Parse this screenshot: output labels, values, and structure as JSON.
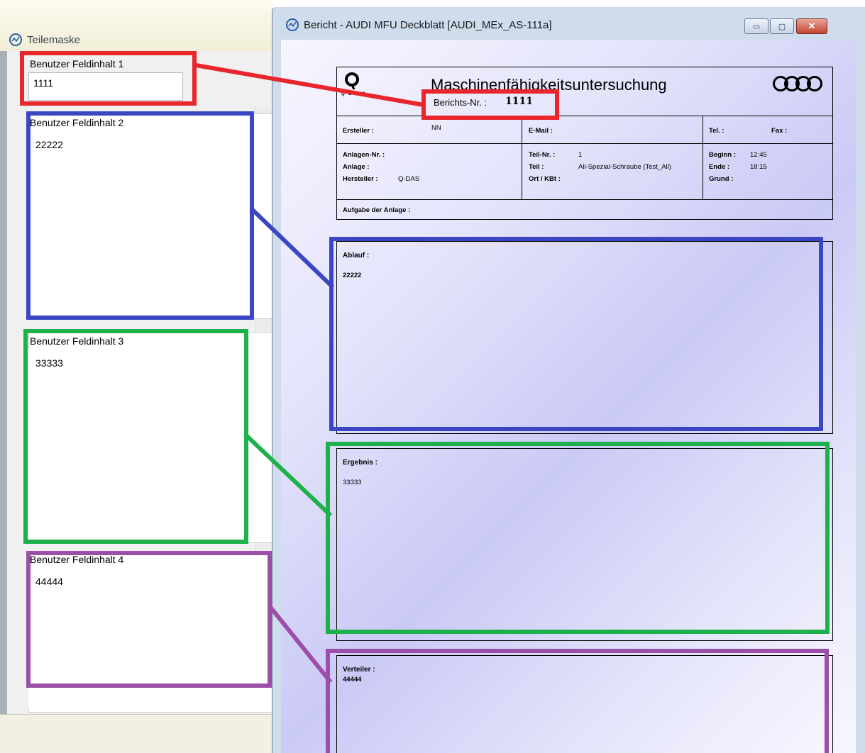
{
  "left_window": {
    "title": "Teilemaske",
    "fields": [
      {
        "label": "Benutzer Feldinhalt 1",
        "value": "1111"
      },
      {
        "label": "Benutzer Feldinhalt 2",
        "value": "22222"
      },
      {
        "label": "Benutzer Feldinhalt 3",
        "value": "33333"
      },
      {
        "label": "Benutzer Feldinhalt 4",
        "value": "44444"
      }
    ]
  },
  "right_window": {
    "title": "Bericht - AUDI MFU Deckblatt  [AUDI_MEx_AS-111a]",
    "buttons": {
      "minimize": "▭",
      "maximize": "▢",
      "close": "✕"
    }
  },
  "report": {
    "heading": "Maschinenfähigkeitsuntersuchung",
    "left_logo_caption": "Q   D   A   S",
    "berichts_nr_label": "Berichts-Nr. :",
    "berichts_nr_value": "1111",
    "row1": {
      "ersteller_label": "Ersteller :",
      "ersteller_value": "NN",
      "email_label": "E-Mail :",
      "tel_label": "Tel. :",
      "fax_label": "Fax :"
    },
    "row2": {
      "anlagen_nr_label": "Anlagen-Nr. :",
      "anlage_label": "Anlage :",
      "hersteller_label": "Hersteller :",
      "hersteller_value": "Q-DAS",
      "teil_nr_label": "Teil-Nr. :",
      "teil_nr_value": "1",
      "teil_label": "Teil :",
      "teil_value": "All-Spezial-Schraube (Test_All)",
      "ort_label": "Ort / KBt :",
      "beginn_label": "Beginn :",
      "beginn_value": "12:45",
      "ende_label": "Ende :",
      "ende_value": "18:15",
      "grund_label": "Grund :"
    },
    "aufgabe_label": "Aufgabe der Anlage  :",
    "ablauf_label": "Ablauf :",
    "ablauf_value": "22222",
    "ergebnis_label": "Ergebnis :",
    "ergebnis_value": "33333",
    "verteiler_label": "Verteiler :",
    "verteiler_value": "44444"
  },
  "annotation_colors": {
    "red": "#e8262c",
    "blue": "#3b46c4",
    "green": "#1db14b",
    "purple": "#9b4fa8"
  }
}
